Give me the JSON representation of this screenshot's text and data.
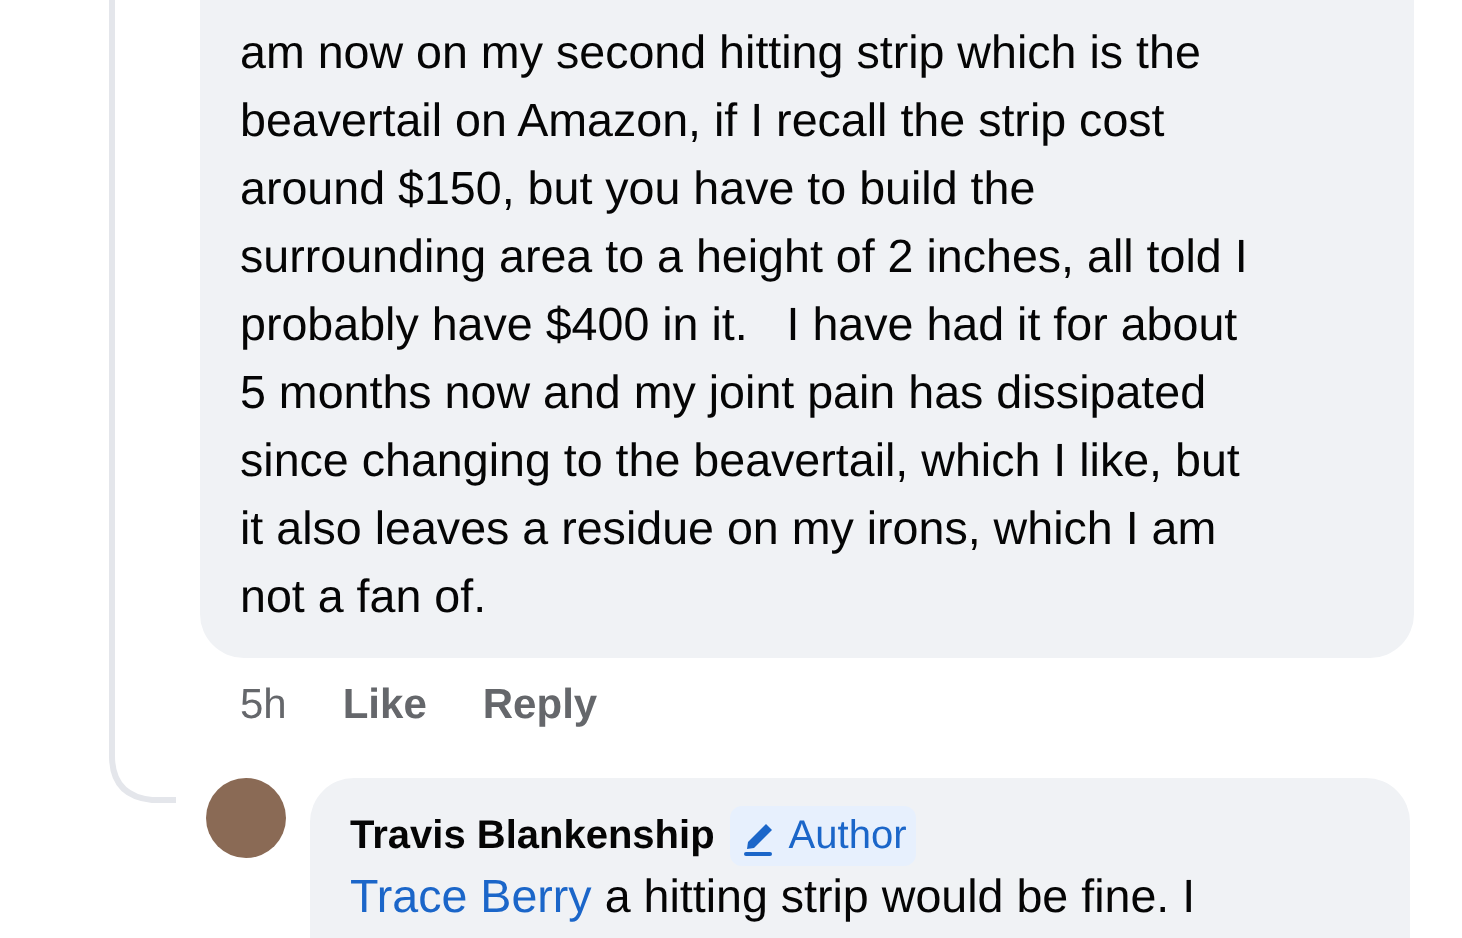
{
  "comment": {
    "lines": [
      "am now on my second hitting strip which is the",
      "beavertail on Amazon, if I recall the strip cost",
      "around $150, but you have to build the",
      "surrounding area to a height of 2 inches, all told I",
      "probably have $400 in it.   I have had it for about",
      "5 months now and my joint pain has dissipated",
      "since changing to the beavertail, which I like, but",
      "it also leaves a residue on my irons, which I am",
      "not a fan of."
    ]
  },
  "actions": {
    "time": "5h",
    "like": "Like",
    "reply": "Reply"
  },
  "reply": {
    "author": "Travis Blankenship",
    "badge": "Author",
    "mention": "Trace Berry",
    "text": "a hitting strip would be fine. I"
  }
}
